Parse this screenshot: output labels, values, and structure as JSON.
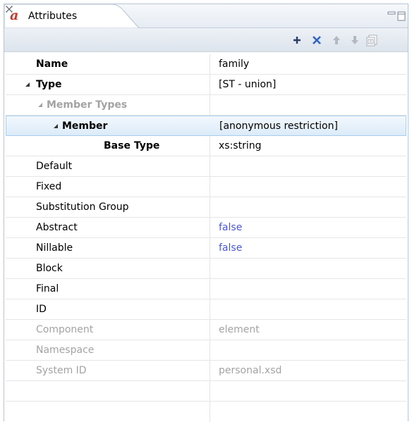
{
  "tab": {
    "logo": "a",
    "title": "Attributes"
  },
  "toolbar": {
    "actions": [
      "add-icon",
      "remove-icon",
      "move-up-icon",
      "move-down-icon",
      "new-view-icon"
    ]
  },
  "rows": [
    {
      "name": "Name",
      "value": "family",
      "style": "bold",
      "indent": 0,
      "expandable": false
    },
    {
      "name": "Type",
      "value": "[ST - union]",
      "style": "bold",
      "indent": 0,
      "expandable": true
    },
    {
      "name": "Member Types",
      "value": "",
      "style": "muted-bold",
      "indent": 1,
      "expandable": true
    },
    {
      "name": "Member",
      "value": "[anonymous restriction]",
      "style": "bold",
      "indent": 2,
      "expandable": true,
      "selected": true
    },
    {
      "name": "Base Type",
      "value": "xs:string",
      "style": "bold",
      "indent": 3,
      "expandable": false
    },
    {
      "name": "Default",
      "value": "",
      "style": "normal",
      "indent": 0,
      "expandable": false
    },
    {
      "name": "Fixed",
      "value": "",
      "style": "normal",
      "indent": 0,
      "expandable": false
    },
    {
      "name": "Substitution Group",
      "value": "",
      "style": "normal",
      "indent": 0,
      "expandable": false
    },
    {
      "name": "Abstract",
      "value": "false",
      "style": "normal",
      "valueStyle": "blue",
      "indent": 0,
      "expandable": false
    },
    {
      "name": "Nillable",
      "value": "false",
      "style": "normal",
      "valueStyle": "blue",
      "indent": 0,
      "expandable": false
    },
    {
      "name": "Block",
      "value": "",
      "style": "normal",
      "indent": 0,
      "expandable": false
    },
    {
      "name": "Final",
      "value": "",
      "style": "normal",
      "indent": 0,
      "expandable": false
    },
    {
      "name": "ID",
      "value": "",
      "style": "normal",
      "indent": 0,
      "expandable": false
    },
    {
      "name": "Component",
      "value": "element",
      "style": "muted",
      "valueStyle": "muted",
      "indent": 0,
      "expandable": false
    },
    {
      "name": "Namespace",
      "value": "",
      "style": "muted",
      "indent": 0,
      "expandable": false
    },
    {
      "name": "System ID",
      "value": "personal.xsd",
      "style": "muted",
      "valueStyle": "muted",
      "indent": 0,
      "expandable": false
    },
    {
      "name": "",
      "value": "",
      "style": "normal",
      "indent": 0,
      "expandable": false
    }
  ]
}
